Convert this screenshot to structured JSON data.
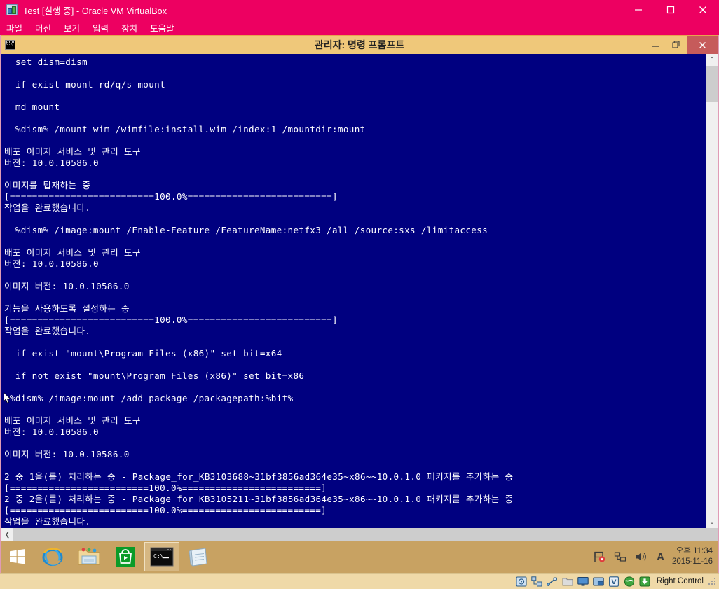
{
  "vbox": {
    "title": "Test [실행 중] - Oracle VM VirtualBox",
    "app_icon": "virtualbox-icon",
    "window_controls": {
      "minimize": "─",
      "maximize": "□",
      "close": "✕"
    },
    "menu": [
      {
        "label": "파일",
        "name": "menu-file"
      },
      {
        "label": "머신",
        "name": "menu-machine"
      },
      {
        "label": "보기",
        "name": "menu-view"
      },
      {
        "label": "입력",
        "name": "menu-input"
      },
      {
        "label": "장치",
        "name": "menu-devices"
      },
      {
        "label": "도움말",
        "name": "menu-help"
      }
    ],
    "titlebar_color": "#ED0061",
    "statusbar": {
      "host_key": "Right Control",
      "icons": [
        "hard-disk-icon",
        "network-icon",
        "usb-icon",
        "shared-folder-icon",
        "display-icon",
        "video-capture-icon",
        "virtualbox-additions-icon",
        "mouse-integration-icon",
        "cpu-icon"
      ]
    }
  },
  "cmd": {
    "title": "관리자: 명령 프롬프트",
    "icon": "command-prompt-icon",
    "titlebar_color": "#EFC87A",
    "background_color": "#000080",
    "text_color": "#FFFFFF",
    "controls": {
      "minimize": "─",
      "restore": "❐",
      "close": "✕"
    },
    "console_text": "  set dism=dism\n\n  if exist mount rd/q/s mount\n\n  md mount\n\n  %dism% /mount-wim /wimfile:install.wim /index:1 /mountdir:mount\n\n배포 이미지 서비스 및 관리 도구\n버전: 10.0.10586.0\n\n이미지를 탑재하는 중\n[==========================100.0%==========================]\n작업을 완료했습니다.\n\n  %dism% /image:mount /Enable-Feature /FeatureName:netfx3 /all /source:sxs /limitaccess\n\n배포 이미지 서비스 및 관리 도구\n버전: 10.0.10586.0\n\n이미지 버전: 10.0.10586.0\n\n기능을 사용하도록 설정하는 중\n[==========================100.0%==========================]\n작업을 완료했습니다.\n\n  if exist \"mount\\Program Files (x86)\" set bit=x64\n\n  if not exist \"mount\\Program Files (x86)\" set bit=x86\n\n %dism% /image:mount /add-package /packagepath:%bit%\n\n배포 이미지 서비스 및 관리 도구\n버전: 10.0.10586.0\n\n이미지 버전: 10.0.10586.0\n\n2 중 1을(를) 처리하는 중 - Package_for_KB3103688~31bf3856ad364e35~x86~~10.0.1.0 패키지를 추가하는 중\n[=========================100.0%=========================]\n2 중 2을(를) 처리하는 중 - Package_for_KB3105211~31bf3856ad364e35~x86~~10.0.1.0 패키지를 추가하는 중\n[=========================100.0%=========================]\n작업을 완료했습니다.",
    "scroll": {
      "up_arrow": "⌃",
      "down_arrow": "⌄",
      "left_arrow": "❮",
      "right_arrow": "❯"
    }
  },
  "taskbar": {
    "background_color": "#C8A262",
    "buttons": [
      {
        "name": "start-button",
        "icon": "windows-logo-icon",
        "active": false
      },
      {
        "name": "taskbar-internet-explorer",
        "icon": "internet-explorer-icon",
        "active": false
      },
      {
        "name": "taskbar-file-explorer",
        "icon": "file-explorer-icon",
        "active": false
      },
      {
        "name": "taskbar-store",
        "icon": "windows-store-icon",
        "active": false
      },
      {
        "name": "taskbar-command-prompt",
        "icon": "command-prompt-icon",
        "active": true
      },
      {
        "name": "taskbar-notepad",
        "icon": "notepad-icon",
        "active": false
      }
    ],
    "tray": {
      "icons": [
        "action-center-flag-error-icon",
        "network-icon",
        "volume-icon"
      ],
      "ime": "A",
      "time": "오후 11:34",
      "date": "2015-11-16"
    }
  }
}
